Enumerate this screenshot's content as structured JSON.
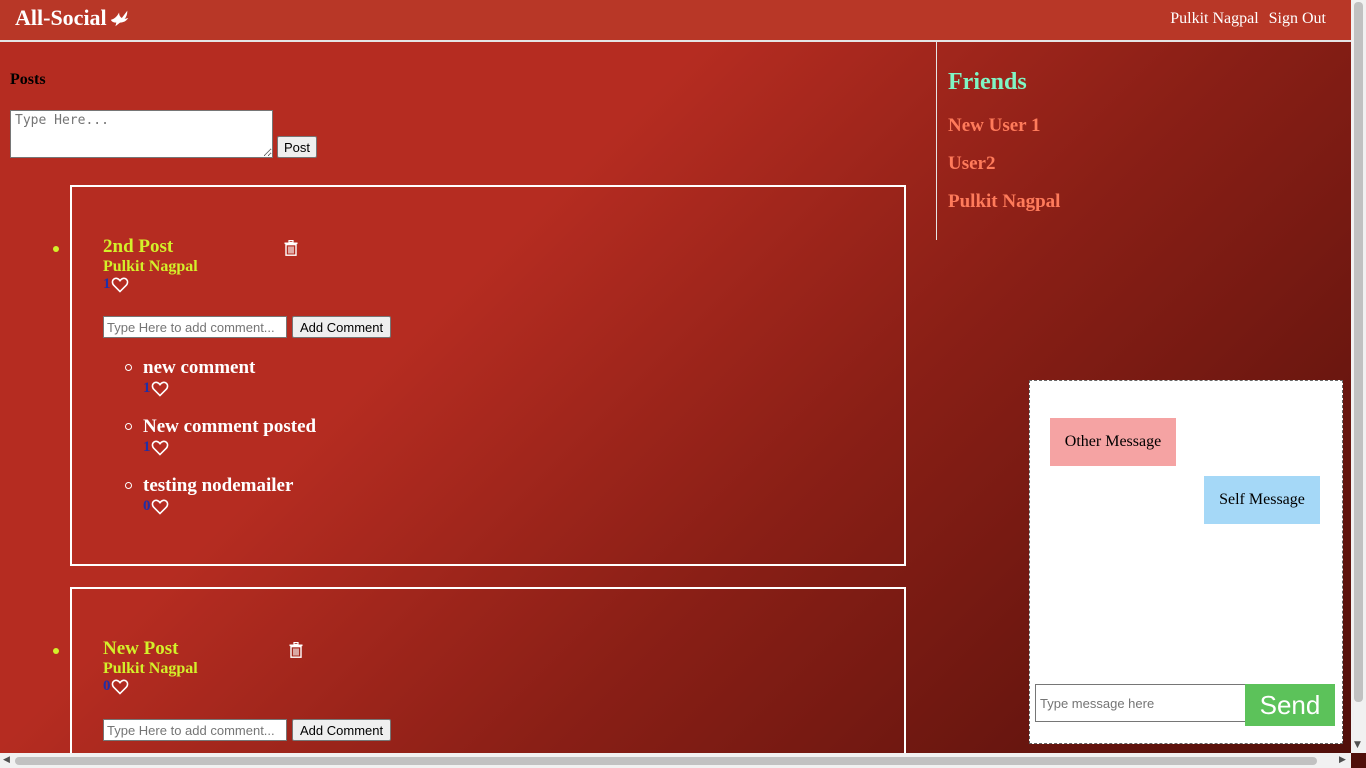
{
  "header": {
    "brand": "All-Social",
    "user_name": "Pulkit Nagpal",
    "sign_out": "Sign Out"
  },
  "posts_section": {
    "heading": "Posts",
    "textarea_placeholder": "Type Here...",
    "post_button": "Post",
    "comment_placeholder": "Type Here to add comment...",
    "comment_button": "Add Comment"
  },
  "posts": [
    {
      "title": "2nd Post",
      "author": "Pulkit Nagpal",
      "likes": "1",
      "comments": [
        {
          "text": "new comment",
          "likes": "1"
        },
        {
          "text": "New comment posted",
          "likes": "1"
        },
        {
          "text": "testing nodemailer",
          "likes": "0"
        }
      ]
    },
    {
      "title": "New Post",
      "author": "Pulkit Nagpal",
      "likes": "0",
      "comments": []
    }
  ],
  "friends": {
    "title": "Friends",
    "items": [
      "New User 1",
      "User2",
      "Pulkit Nagpal"
    ]
  },
  "chat": {
    "other_message": "Other Message",
    "self_message": "Self Message",
    "input_placeholder": "Type message here",
    "send_button": "Send"
  },
  "colors": {
    "accent": "#d3f02a",
    "friends_title": "#7ff5c4",
    "friend_link": "#ff7b5b",
    "like_count": "#1f2fa8",
    "send_button": "#5cc25a"
  }
}
